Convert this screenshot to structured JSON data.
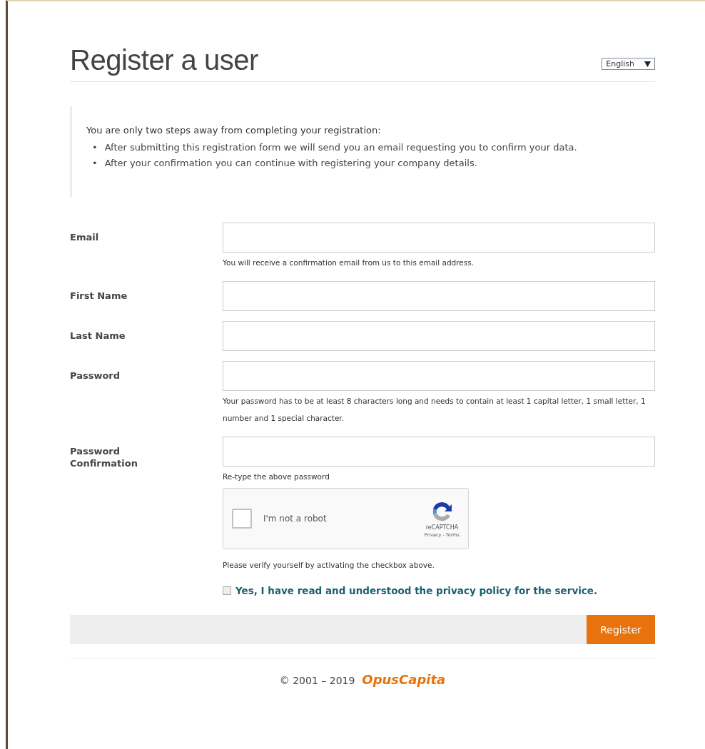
{
  "title": "Register a user",
  "language": {
    "value": "English"
  },
  "info": {
    "heading": "You are only two steps away from completing your registration:",
    "items": [
      {
        "marker": "•",
        "text": "After submitting this registration form we will send you an email requesting you to confirm your data."
      },
      {
        "marker": "•",
        "text": "After your confirmation you can continue with registering your company details."
      }
    ]
  },
  "fields": [
    {
      "label": "Email",
      "hint": [
        "You will receive a confirmation email from us to this email address."
      ]
    },
    {
      "label": "First Name"
    },
    {
      "label": "Last Name"
    },
    {
      "label": "Password",
      "hint": [
        "Your password has to be at least 8 characters long and needs to contain at least 1 capital letter, 1 small letter, 1 number and 1 special character."
      ]
    },
    {
      "label": "Password Confirmation",
      "hint": [
        "Re-type the above password"
      ]
    }
  ],
  "captcha": {
    "label": "I'm not a robot",
    "checked": false,
    "brand": "reCAPTCHA",
    "links": "Privacy - Terms"
  },
  "verify_note": "Please verify yourself by activating the checkbox above.",
  "privacy": {
    "label": "Yes, I have read and understood the privacy policy for the service.",
    "checked": false
  },
  "register_button": "Register",
  "footer": {
    "copyright": "© 2001 – 2019",
    "brand": "OpusCapita"
  }
}
